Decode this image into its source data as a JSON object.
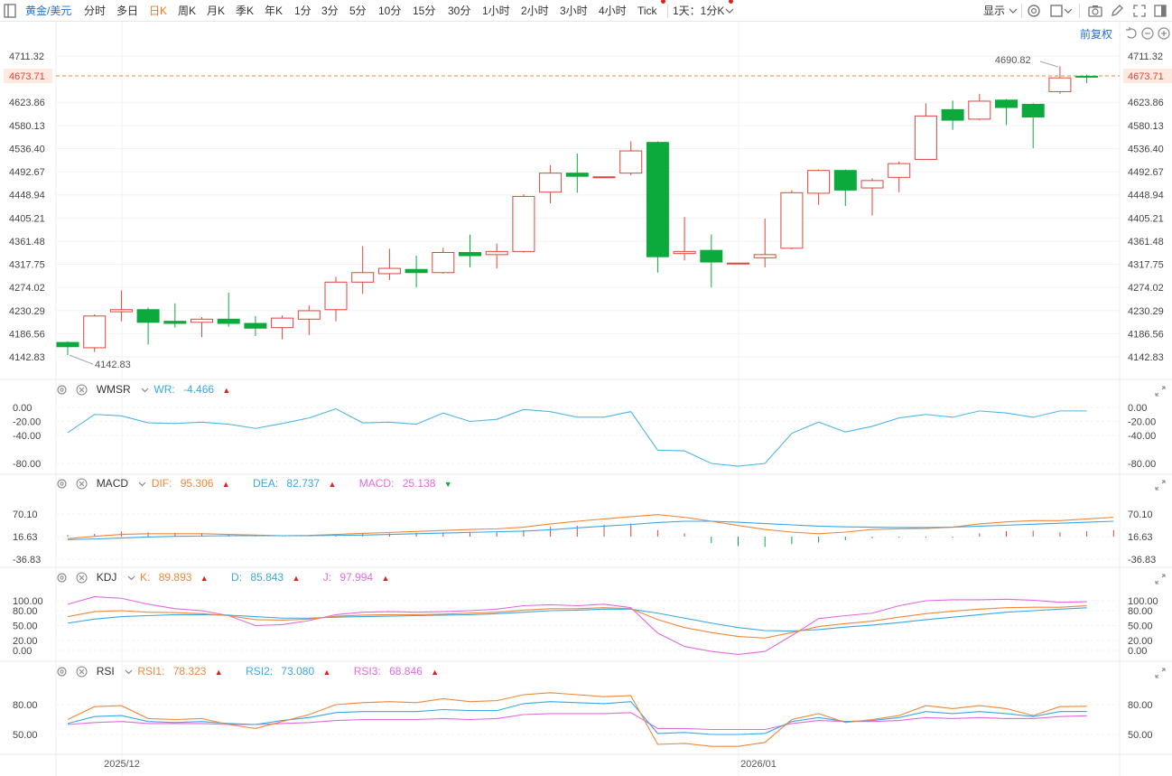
{
  "toolbar": {
    "symbol": "黄金/美元",
    "periods": [
      "分时",
      "多日",
      "日K",
      "周K",
      "月K",
      "季K",
      "年K",
      "1分",
      "3分",
      "5分",
      "10分",
      "15分",
      "30分",
      "1小时",
      "2小时",
      "3小时",
      "4小时",
      "Tick"
    ],
    "active_period": "日K",
    "multi_period": "1天：1分K",
    "display_label": "显示"
  },
  "price_axis": {
    "labels": [
      "4711.32",
      "4673.71",
      "4623.86",
      "4580.13",
      "4536.40",
      "4492.67",
      "4448.94",
      "4405.21",
      "4361.48",
      "4317.75",
      "4274.02",
      "4230.29",
      "4186.56",
      "4142.83"
    ],
    "last_price": "4673.71",
    "fuquan_label": "前复权"
  },
  "markers": {
    "high": "4690.82",
    "low": "4142.83"
  },
  "colors": {
    "up": "#e0453a",
    "down": "#0caa3c",
    "accent": "#1f6fd1",
    "last_line": "#f0873a"
  },
  "candles": [
    {
      "o": 4170,
      "h": 4172,
      "l": 4146,
      "c": 4162
    },
    {
      "o": 4160,
      "h": 4223,
      "l": 4152,
      "c": 4220
    },
    {
      "o": 4228,
      "h": 4268,
      "l": 4210,
      "c": 4232
    },
    {
      "o": 4232,
      "h": 4236,
      "l": 4166,
      "c": 4208
    },
    {
      "o": 4210,
      "h": 4244,
      "l": 4198,
      "c": 4206
    },
    {
      "o": 4208,
      "h": 4218,
      "l": 4180,
      "c": 4214
    },
    {
      "o": 4214,
      "h": 4264,
      "l": 4200,
      "c": 4206
    },
    {
      "o": 4206,
      "h": 4220,
      "l": 4182,
      "c": 4197
    },
    {
      "o": 4198,
      "h": 4221,
      "l": 4176,
      "c": 4216
    },
    {
      "o": 4214,
      "h": 4240,
      "l": 4184,
      "c": 4230
    },
    {
      "o": 4232,
      "h": 4294,
      "l": 4210,
      "c": 4284
    },
    {
      "o": 4284,
      "h": 4352,
      "l": 4262,
      "c": 4302
    },
    {
      "o": 4300,
      "h": 4347,
      "l": 4288,
      "c": 4310
    },
    {
      "o": 4308,
      "h": 4334,
      "l": 4274,
      "c": 4302
    },
    {
      "o": 4302,
      "h": 4349,
      "l": 4300,
      "c": 4340
    },
    {
      "o": 4340,
      "h": 4374,
      "l": 4312,
      "c": 4334
    },
    {
      "o": 4336,
      "h": 4357,
      "l": 4310,
      "c": 4342
    },
    {
      "o": 4342,
      "h": 4450,
      "l": 4340,
      "c": 4446
    },
    {
      "o": 4454,
      "h": 4505,
      "l": 4433,
      "c": 4490
    },
    {
      "o": 4490,
      "h": 4527,
      "l": 4453,
      "c": 4484
    },
    {
      "o": 4483,
      "h": 4483,
      "l": 4483,
      "c": 4483
    },
    {
      "o": 4490,
      "h": 4550,
      "l": 4486,
      "c": 4532
    },
    {
      "o": 4548,
      "h": 4550,
      "l": 4302,
      "c": 4332
    },
    {
      "o": 4338,
      "h": 4407,
      "l": 4325,
      "c": 4342
    },
    {
      "o": 4344,
      "h": 4374,
      "l": 4274,
      "c": 4322
    },
    {
      "o": 4320,
      "h": 4320,
      "l": 4320,
      "c": 4320
    },
    {
      "o": 4330,
      "h": 4404,
      "l": 4312,
      "c": 4336
    },
    {
      "o": 4348,
      "h": 4458,
      "l": 4346,
      "c": 4453
    },
    {
      "o": 4452,
      "h": 4497,
      "l": 4430,
      "c": 4495
    },
    {
      "o": 4495,
      "h": 4497,
      "l": 4428,
      "c": 4458
    },
    {
      "o": 4462,
      "h": 4480,
      "l": 4410,
      "c": 4476
    },
    {
      "o": 4482,
      "h": 4512,
      "l": 4454,
      "c": 4508
    },
    {
      "o": 4516,
      "h": 4622,
      "l": 4516,
      "c": 4598
    },
    {
      "o": 4610,
      "h": 4627,
      "l": 4572,
      "c": 4590
    },
    {
      "o": 4592,
      "h": 4640,
      "l": 4590,
      "c": 4626
    },
    {
      "o": 4628,
      "h": 4630,
      "l": 4581,
      "c": 4614
    },
    {
      "o": 4620,
      "h": 4622,
      "l": 4537,
      "c": 4596
    },
    {
      "o": 4644,
      "h": 4692,
      "l": 4640,
      "c": 4670
    },
    {
      "o": 4673,
      "h": 4676,
      "l": 4660,
      "c": 4672
    }
  ],
  "date_labels": [
    "2025/12",
    "2026/01"
  ],
  "wr": {
    "name": "WMSR",
    "param_label": "WR:",
    "value": "-4.466",
    "axis_labels": [
      "0.00",
      "-20.00",
      "-40.00",
      "-80.00"
    ],
    "series": [
      -36,
      -10,
      -12,
      -22,
      -23,
      -21,
      -24,
      -30,
      -23,
      -15,
      -2,
      -22,
      -21,
      -24,
      -8,
      -20,
      -17,
      -3,
      -6,
      -14,
      -14,
      -6,
      -61,
      -62,
      -80,
      -84,
      -80,
      -37,
      -21,
      -35,
      -27,
      -15,
      -10,
      -14,
      -5,
      -8,
      -14,
      -5,
      -5
    ]
  },
  "macd": {
    "name": "MACD",
    "dif_label": "DIF:",
    "dif": "95.306",
    "dea_label": "DEA:",
    "dea": "82.737",
    "macd_label": "MACD:",
    "macd": "25.138",
    "axis_labels": [
      "70.10",
      "16.63",
      "-36.83"
    ],
    "dif_series": [
      35,
      42,
      48,
      50,
      50,
      50,
      48,
      46,
      44,
      45,
      48,
      51,
      54,
      57,
      60,
      63,
      65,
      70,
      80,
      88,
      95,
      102,
      108,
      100,
      88,
      75,
      63,
      55,
      50,
      55,
      63,
      65,
      66,
      70,
      80,
      86,
      90,
      90,
      95,
      100
    ],
    "dea_series": [
      32,
      34,
      37,
      40,
      42,
      43,
      44,
      44,
      44,
      44,
      45,
      46,
      48,
      50,
      52,
      54,
      56,
      58,
      62,
      68,
      73,
      78,
      84,
      88,
      88,
      85,
      81,
      77,
      73,
      71,
      70,
      69,
      69,
      70,
      73,
      76,
      79,
      82,
      85,
      88
    ],
    "hist_series": [
      6,
      10,
      19,
      16,
      14,
      13,
      8,
      4,
      1,
      1,
      5,
      10,
      12,
      14,
      16,
      18,
      18,
      24,
      36,
      40,
      44,
      48,
      24,
      12,
      -24,
      -35,
      -38,
      -28,
      -22,
      -13,
      -6,
      -4,
      -4,
      -4,
      12,
      20,
      22,
      16,
      20,
      24
    ]
  },
  "kdj": {
    "name": "KDJ",
    "k_label": "K:",
    "k": "89.893",
    "d_label": "D:",
    "d": "85.843",
    "j_label": "J:",
    "j": "97.994",
    "axis_labels": [
      "100.00",
      "80.00",
      "50.00",
      "20.00",
      "0.00"
    ],
    "k_series": [
      68,
      78,
      80,
      77,
      76,
      74,
      70,
      62,
      61,
      63,
      69,
      71,
      72,
      72,
      73,
      75,
      77,
      81,
      84,
      84,
      86,
      84,
      62,
      46,
      36,
      28,
      25,
      36,
      48,
      54,
      59,
      67,
      74,
      79,
      83,
      86,
      87,
      87,
      89.893
    ],
    "d_series": [
      55,
      63,
      68,
      70,
      72,
      72,
      71,
      68,
      65,
      65,
      67,
      68,
      69,
      70,
      71,
      72,
      74,
      77,
      80,
      81,
      83,
      83,
      75,
      65,
      55,
      46,
      40,
      39,
      42,
      47,
      51,
      56,
      62,
      67,
      72,
      77,
      80,
      83,
      85.843
    ],
    "j_series": [
      93,
      108,
      105,
      93,
      84,
      80,
      70,
      50,
      52,
      60,
      72,
      77,
      78,
      77,
      78,
      80,
      83,
      90,
      92,
      90,
      93,
      86,
      35,
      8,
      -2,
      -8,
      -2,
      30,
      64,
      70,
      75,
      90,
      100,
      102,
      102,
      103,
      101,
      97,
      97.994
    ]
  },
  "rsi": {
    "name": "RSI",
    "rsi1_label": "RSI1:",
    "rsi1": "78.323",
    "rsi2_label": "RSI2:",
    "rsi2": "73.080",
    "rsi3_label": "RSI3:",
    "rsi3": "68.846",
    "axis_labels": [
      "80.00",
      "50.00"
    ],
    "rsi1_series": [
      65,
      78,
      79,
      66,
      65,
      66,
      60,
      56,
      63,
      70,
      80,
      82,
      83,
      82,
      86,
      83,
      84,
      90,
      92,
      90,
      88,
      89,
      40,
      41,
      38,
      38,
      42,
      65,
      71,
      62,
      65,
      69,
      79,
      76,
      79,
      76,
      69,
      78,
      78.323
    ],
    "rsi2_series": [
      61,
      68,
      69,
      63,
      62,
      63,
      61,
      60,
      64,
      67,
      72,
      73,
      73,
      73,
      75,
      74,
      74,
      81,
      83,
      82,
      81,
      83,
      51,
      52,
      50,
      50,
      51,
      63,
      67,
      63,
      64,
      67,
      73,
      71,
      73,
      71,
      68,
      73,
      73.08
    ],
    "rsi3_series": [
      60,
      62,
      63,
      61,
      61,
      61,
      60,
      60,
      61,
      62,
      64,
      65,
      65,
      65,
      66,
      65,
      66,
      70,
      71,
      71,
      71,
      72,
      56,
      56,
      55,
      55,
      55,
      61,
      64,
      63,
      63,
      64,
      67,
      66,
      67,
      66,
      66,
      68,
      68.846
    ]
  }
}
